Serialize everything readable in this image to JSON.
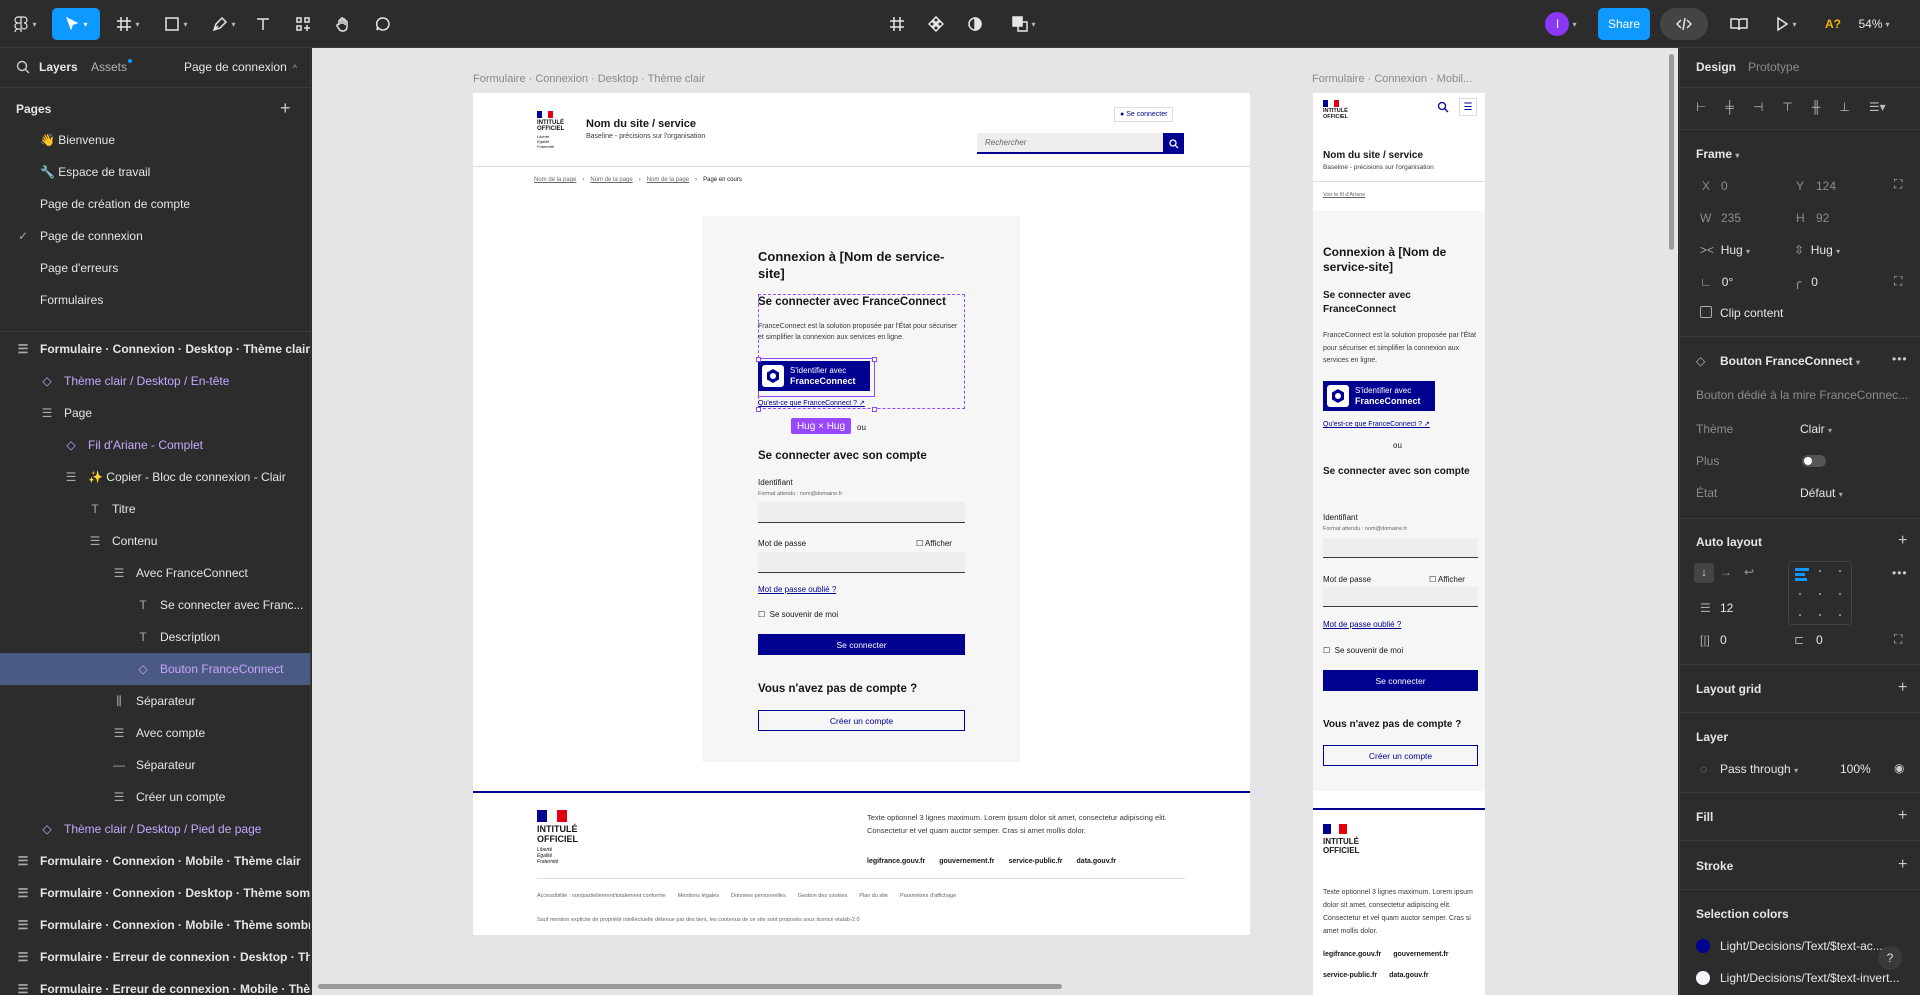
{
  "toolbar": {
    "share_label": "Share",
    "zoom": "54%",
    "avatar_initial": "I",
    "accent": "#0d99ff"
  },
  "left_panel": {
    "tab_layers": "Layers",
    "tab_assets": "Assets",
    "current_page": "Page de connexion",
    "pages_heading": "Pages",
    "pages": [
      {
        "label": "👋 Bienvenue"
      },
      {
        "label": "🔧 Espace de travail"
      },
      {
        "label": "Page de création de compte"
      },
      {
        "label": "Page de connexion"
      },
      {
        "label": "Page d'erreurs"
      },
      {
        "label": "Formulaires"
      }
    ],
    "layers": [
      {
        "label": "Formulaire · Connexion · Desktop · Thème clair"
      },
      {
        "label": "Thème clair / Desktop / En-tête"
      },
      {
        "label": "Page"
      },
      {
        "label": "Fil d'Ariane - Complet"
      },
      {
        "label": "✨ Copier - Bloc de connexion - Clair"
      },
      {
        "label": "Titre"
      },
      {
        "label": "Contenu"
      },
      {
        "label": "Avec FranceConnect"
      },
      {
        "label": "Se connecter avec Franc..."
      },
      {
        "label": "Description"
      },
      {
        "label": "Bouton FranceConnect"
      },
      {
        "label": "Séparateur"
      },
      {
        "label": "Avec compte"
      },
      {
        "label": "Séparateur"
      },
      {
        "label": "Créer un compte"
      },
      {
        "label": "Thème clair / Desktop / Pied de page"
      },
      {
        "label": "Formulaire · Connexion · Mobile · Thème clair"
      },
      {
        "label": "Formulaire · Connexion · Desktop · Thème som..."
      },
      {
        "label": "Formulaire · Connexion · Mobile · Thème sombre"
      },
      {
        "label": "Formulaire · Erreur de connexion · Desktop · Th..."
      },
      {
        "label": "Formulaire · Erreur de connexion · Mobile · Thè..."
      }
    ]
  },
  "canvas": {
    "desktop_label": "Formulaire · Connexion · Desktop · Thème clair",
    "mobile_label": "Formulaire · Connexion · Mobil...",
    "hug_badge": "Hug × Hug",
    "colors": {
      "brand_blue": "#000091",
      "brand_red": "#e1000f",
      "figma_purple": "#9747ff"
    },
    "desktop": {
      "logo_line1": "INTITULÉ",
      "logo_line2": "OFFICIEL",
      "logo_motto": "Liberté Égalité Fraternité",
      "site_name": "Nom du site / service",
      "baseline": "Baseline - précisions sur l'organisation",
      "login_link": "Se connecter",
      "search_placeholder": "Rechercher",
      "breadcrumb": [
        "Nom de la page",
        "Nom de la page",
        "Nom de la page",
        "Page en cours"
      ],
      "form_title": "Connexion à [Nom de service-site]",
      "fc_title": "Se connecter avec FranceConnect",
      "fc_desc": "FranceConnect est la solution proposée par l'État pour sécuriser et simplifier la connexion aux services en ligne.",
      "fc_btn_line1": "S'identifier avec",
      "fc_btn_line2": "FranceConnect",
      "fc_what": "Qu'est-ce que FranceConnect ?",
      "or": "ou",
      "account_title": "Se connecter avec son compte",
      "id_label": "Identifiant",
      "id_hint": "Format attendu : nom@domaine.fr",
      "pw_label": "Mot de passe",
      "show_label": "Afficher",
      "forgot": "Mot de passe oublié ?",
      "remember": "Se souvenir de moi",
      "submit": "Se connecter",
      "no_account": "Vous n'avez pas de compte ?",
      "create": "Créer un compte",
      "footer_text": "Texte optionnel 3 lignes maximum. Lorem ipsum dolor sit amet, consectetur adipiscing elit. Consectetur et vel quam auctor semper. Cras si amet mollis dolor.",
      "footer_links": [
        "legifrance.gouv.fr",
        "gouvernement.fr",
        "service-public.fr",
        "data.gouv.fr"
      ],
      "bottom_links": [
        "Accessibilité : non/partiellement/totalement conforme",
        "Mentions légales",
        "Données personnelles",
        "Gestion des cookies",
        "Plan du site",
        "Paramètres d'affichage"
      ],
      "license": "Sauf mention explicite de propriété intellectuelle détenue par des tiers, les contenus de ce site sont proposés sous licence etalab-2.0"
    },
    "mobile": {
      "site_name": "Nom du site / service",
      "baseline": "Baseline - précisions sur l'organisation",
      "breadcrumb_link": "Voir le fil d'Ariane",
      "form_title": "Connexion à [Nom de service-site]",
      "fc_title": "Se connecter avec FranceConnect",
      "fc_desc": "FranceConnect est la solution proposée par l'État pour sécuriser et simplifier la connexion aux services en ligne.",
      "fc_what": "Qu'est-ce que FranceConnect ?",
      "or": "ou",
      "account_title": "Se connecter avec son compte",
      "id_label": "Identifiant",
      "id_hint": "Format attendu : nom@domaine.fr",
      "pw_label": "Mot de passe",
      "show_label": "Afficher",
      "forgot": "Mot de passe oublié ?",
      "remember": "Se souvenir de moi",
      "submit": "Se connecter",
      "no_account": "Vous n'avez pas de compte ?",
      "create": "Créer un compte",
      "footer_text": "Texte optionnel 3 lignes maximum. Lorem ipsum dolor sit amet, consectetur adipiscing elit. Consectetur et vel quam auctor semper. Cras si amet mollis dolor.",
      "footer_links": [
        "legifrance.gouv.fr",
        "gouvernement.fr",
        "service-public.fr",
        "data.gouv.fr"
      ]
    }
  },
  "right_panel": {
    "tab_design": "Design",
    "tab_prototype": "Prototype",
    "frame_heading": "Frame",
    "x_label": "X",
    "x_value": "0",
    "y_label": "Y",
    "y_value": "124",
    "w_label": "W",
    "w_value": "235",
    "h_label": "H",
    "h_value": "92",
    "width_mode": "Hug",
    "height_mode": "Hug",
    "rotation": "0°",
    "radius": "0",
    "clip_content": "Clip content",
    "component_name": "Bouton FranceConnect",
    "component_desc": "Bouton dédié à la mire FranceConnec...",
    "props": [
      {
        "label": "Thème",
        "value": "Clair"
      },
      {
        "label": "Plus",
        "value": ""
      },
      {
        "label": "État",
        "value": "Défaut"
      }
    ],
    "auto_layout_heading": "Auto layout",
    "gap": "12",
    "pad_h": "0",
    "pad_v": "0",
    "layout_grid_heading": "Layout grid",
    "layer_heading": "Layer",
    "blend_mode": "Pass through",
    "opacity": "100%",
    "fill_heading": "Fill",
    "stroke_heading": "Stroke",
    "selection_colors_heading": "Selection colors",
    "selection_colors": [
      {
        "name": "Light/Decisions/Text/$text-ac...",
        "hex": "#000091"
      },
      {
        "name": "Light/Decisions/Text/$text-invert...",
        "hex": "#f5f5fe"
      }
    ],
    "help": "?"
  }
}
